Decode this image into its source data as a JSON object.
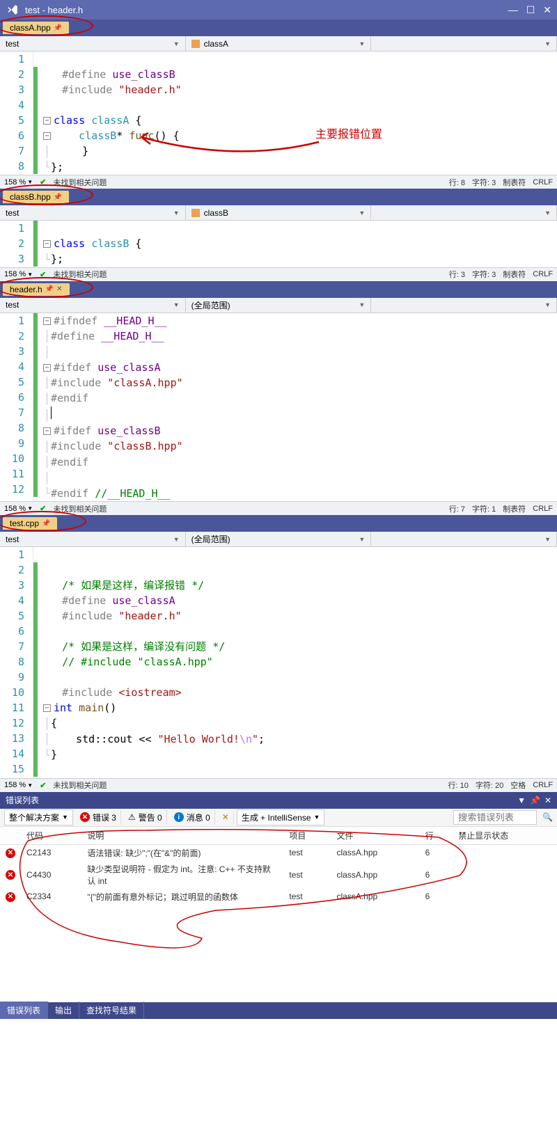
{
  "title_bar": {
    "title": "test - header.h"
  },
  "panes": [
    {
      "tab": "classA.hpp",
      "nav_left": "test",
      "nav_right": "classA",
      "status": {
        "zoom": "158 %",
        "issue": "未找到相关问题",
        "line": "行: 8",
        "col": "字符: 3",
        "ins": "制表符",
        "enc": "CRLF"
      },
      "lines": [
        "1",
        "2",
        "3",
        "4",
        "5",
        "6",
        "7",
        "8"
      ],
      "annotation": "主要报错位置"
    },
    {
      "tab": "classB.hpp",
      "nav_left": "test",
      "nav_right": "classB",
      "status": {
        "zoom": "158 %",
        "issue": "未找到相关问题",
        "line": "行: 3",
        "col": "字符: 3",
        "ins": "制表符",
        "enc": "CRLF"
      },
      "lines": [
        "1",
        "2",
        "3"
      ]
    },
    {
      "tab": "header.h",
      "nav_left": "test",
      "nav_right": "(全局范围)",
      "status": {
        "zoom": "158 %",
        "issue": "未找到相关问题",
        "line": "行: 7",
        "col": "字符: 1",
        "ins": "制表符",
        "enc": "CRLF"
      },
      "lines": [
        "1",
        "2",
        "3",
        "4",
        "5",
        "6",
        "7",
        "8",
        "9",
        "10",
        "11",
        "12"
      ]
    },
    {
      "tab": "test.cpp",
      "nav_left": "test",
      "nav_right": "(全局范围)",
      "status": {
        "zoom": "158 %",
        "issue": "未找到相关问题",
        "line": "行: 10",
        "col": "字符: 20",
        "ins": "空格",
        "enc": "CRLF"
      },
      "lines": [
        "1",
        "2",
        "3",
        "4",
        "5",
        "6",
        "7",
        "8",
        "9",
        "10",
        "11",
        "12",
        "13",
        "14",
        "15"
      ]
    }
  ],
  "code": {
    "classA": {
      "l2_def": "#define ",
      "l2_name": "use_classB",
      "l3_inc": "#include ",
      "l3_str": "\"header.h\"",
      "l5_class": "class ",
      "l5_name": "classA",
      "l5_brace": " {",
      "l6_type": "classB",
      "l6_star": "* ",
      "l6_func": "func",
      "l6_rest": "() {",
      "l7": "}",
      "l8": "};"
    },
    "classB": {
      "l2_class": "class ",
      "l2_name": "classB",
      "l2_brace": " {",
      "l3": "};"
    },
    "header": {
      "l1_if": "#ifndef ",
      "l1_name": "__HEAD_H__",
      "l2_def": "#define ",
      "l2_name": "__HEAD_H__",
      "l4_if": "#ifdef ",
      "l4_name": "use_classA",
      "l5_inc": "#include ",
      "l5_str": "\"classA.hpp\"",
      "l6_end": "#endif",
      "l8_if": "#ifdef ",
      "l8_name": "use_classB",
      "l9_inc": "#include ",
      "l9_str": "\"classB.hpp\"",
      "l10_end": "#endif",
      "l12_end": "#endif ",
      "l12_cmt": "//__HEAD_H__"
    },
    "testcpp": {
      "l3_cmt": "/* 如果是这样，编译报错 */",
      "l4_def": "#define ",
      "l4_name": "use_classA",
      "l5_inc": "#include ",
      "l5_str": "\"header.h\"",
      "l7_cmt": "/* 如果是这样，编译没有问题 */",
      "l8_cmt": "// #include \"classA.hpp\"",
      "l10_inc": "#include ",
      "l10_lt": "<iostream>",
      "l11_int": "int ",
      "l11_main": "main",
      "l11_par": "()",
      "l12": "{",
      "l13_pre": "    std::cout << ",
      "l13_str": "\"Hello World!",
      "l13_esc": "\\n",
      "l13_end": "\"",
      "l13_semi": ";",
      "l14": "}"
    }
  },
  "error_panel": {
    "title": "错误列表",
    "filter": {
      "scope": "整个解决方案",
      "errors": "错误 3",
      "warnings": "警告 0",
      "messages": "消息 0",
      "source": "生成 + IntelliSense",
      "search": "搜索错误列表"
    },
    "headers": {
      "code": "代码",
      "desc": "说明",
      "project": "项目",
      "file": "文件",
      "line": "行",
      "suppress": "禁止显示状态"
    },
    "rows": [
      {
        "code": "C2143",
        "desc": "语法错误: 缺少\";\"(在\"&\"的前面)",
        "project": "test",
        "file": "classA.hpp",
        "line": "6"
      },
      {
        "code": "C4430",
        "desc": "缺少类型说明符 - 假定为 int。注意: C++ 不支持默认 int",
        "project": "test",
        "file": "classA.hpp",
        "line": "6"
      },
      {
        "code": "C2334",
        "desc": "\"{\"的前面有意外标记；跳过明显的函数体",
        "project": "test",
        "file": "classA.hpp",
        "line": "6"
      }
    ]
  },
  "bottom_tabs": {
    "t1": "错误列表",
    "t2": "输出",
    "t3": "查找符号结果"
  }
}
